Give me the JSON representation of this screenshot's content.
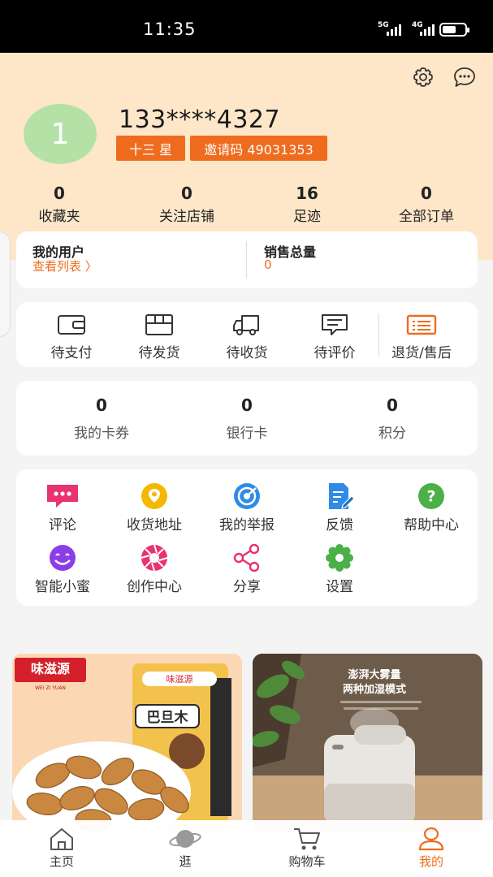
{
  "status_bar": {
    "time": "11:35",
    "signal_1": "5G",
    "signal_2": "4G"
  },
  "header": {
    "settings_icon": "gear-icon",
    "message_icon": "chat-bubble-icon",
    "avatar_text": "1",
    "phone": "133****4327",
    "level_tag": "十三 星",
    "invite_tag": "邀请码 49031353"
  },
  "stats": [
    {
      "value": "0",
      "label": "收藏夹"
    },
    {
      "value": "0",
      "label": "关注店铺"
    },
    {
      "value": "16",
      "label": "足迹"
    },
    {
      "value": "0",
      "label": "全部订单"
    }
  ],
  "users_card": {
    "my_users_title": "我的用户",
    "view_list_link": "查看列表 〉",
    "sales_title": "销售总量",
    "sales_value": "0"
  },
  "orders": [
    {
      "label": "待支付",
      "icon": "wallet-icon"
    },
    {
      "label": "待发货",
      "icon": "box-icon"
    },
    {
      "label": "待收货",
      "icon": "truck-icon"
    },
    {
      "label": "待评价",
      "icon": "comment-icon"
    },
    {
      "label": "退货/售后",
      "icon": "return-card-icon"
    }
  ],
  "wallet": [
    {
      "value": "0",
      "label": "我的卡券"
    },
    {
      "value": "0",
      "label": "银行卡"
    },
    {
      "value": "0",
      "label": "积分"
    }
  ],
  "services": [
    {
      "label": "评论",
      "icon": "comment-dots-icon",
      "color": "#e8336e"
    },
    {
      "label": "收货地址",
      "icon": "location-pin-icon",
      "color": "#f5b800"
    },
    {
      "label": "我的举报",
      "icon": "target-icon",
      "color": "#2f8be6"
    },
    {
      "label": "反馈",
      "icon": "edit-document-icon",
      "color": "#2f8be6"
    },
    {
      "label": "帮助中心",
      "icon": "question-icon",
      "color": "#4cb048"
    },
    {
      "label": "智能小蜜",
      "icon": "smile-assistant-icon",
      "color": "#8b3ee8"
    },
    {
      "label": "创作中心",
      "icon": "aperture-icon",
      "color": "#e8336e"
    },
    {
      "label": "分享",
      "icon": "share-icon",
      "color": "#e8336e"
    },
    {
      "label": "设置",
      "icon": "gear-icon",
      "color": "#4cb048"
    }
  ],
  "products": {
    "left_brand": "味滋源",
    "left_brand_sub": "WEI ZI YUAN",
    "left_pack_name": "巴旦木",
    "right_title_1": "澎湃大雾量",
    "right_title_2": "两种加湿模式"
  },
  "tabbar": [
    {
      "label": "主页",
      "icon": "home-icon"
    },
    {
      "label": "逛",
      "icon": "planet-icon"
    },
    {
      "label": "购物车",
      "icon": "cart-icon"
    },
    {
      "label": "我的",
      "icon": "person-icon"
    }
  ],
  "colors": {
    "accent": "#ef6b1e",
    "header_bg": "#fde7c8",
    "avatar_bg": "#b4e2a6"
  }
}
